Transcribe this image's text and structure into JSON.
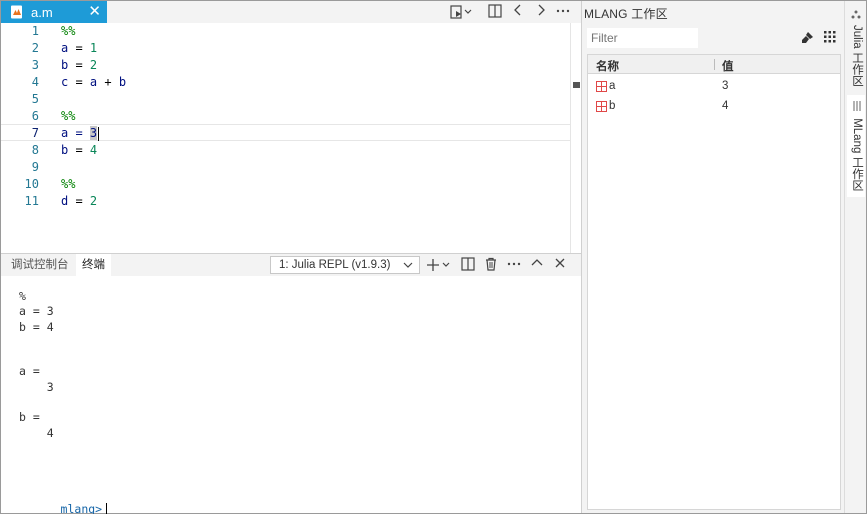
{
  "editor": {
    "tab": {
      "label": "a.m",
      "close": "✕"
    },
    "toolbar": {
      "run_icon": "run-dropdown-icon",
      "split_icon": "split-editor-icon",
      "back_icon": "chevron-left-icon",
      "forward_icon": "chevron-right-icon",
      "more_icon": "more-icon"
    },
    "lines": [
      {
        "no": "1",
        "text": "%%"
      },
      {
        "no": "2",
        "text": "a = 1"
      },
      {
        "no": "3",
        "text": "b = 2"
      },
      {
        "no": "4",
        "text": "c = a + b"
      },
      {
        "no": "5",
        "text": ""
      },
      {
        "no": "6",
        "text": "%%"
      },
      {
        "no": "7",
        "text": "a = 3"
      },
      {
        "no": "8",
        "text": "b = 4"
      },
      {
        "no": "9",
        "text": ""
      },
      {
        "no": "10",
        "text": "%%"
      },
      {
        "no": "11",
        "text": "d = 2"
      }
    ]
  },
  "panel": {
    "tabs": [
      "调试控制台",
      "终端"
    ],
    "active_tab": "终端",
    "terminal_select": "1: Julia REPL (v1.9.3)",
    "output": [
      "%",
      "a = 3",
      "b = 4",
      "",
      "",
      "a =",
      "    3",
      "",
      "b =",
      "    4"
    ],
    "prompt": "mlang>"
  },
  "workspace": {
    "title": "MLANG 工作区",
    "filter_placeholder": "Filter",
    "columns": [
      "名称",
      "值"
    ],
    "rows": [
      {
        "name": "a",
        "value": "3"
      },
      {
        "name": "b",
        "value": "4"
      }
    ]
  },
  "side_tabs": [
    "Julia 工作区",
    "MLang 工作区"
  ],
  "colors": {
    "accent": "#1e9bd7",
    "line_number": "#237893",
    "identifier": "#001080",
    "comment": "#008000",
    "number": "#098658"
  }
}
